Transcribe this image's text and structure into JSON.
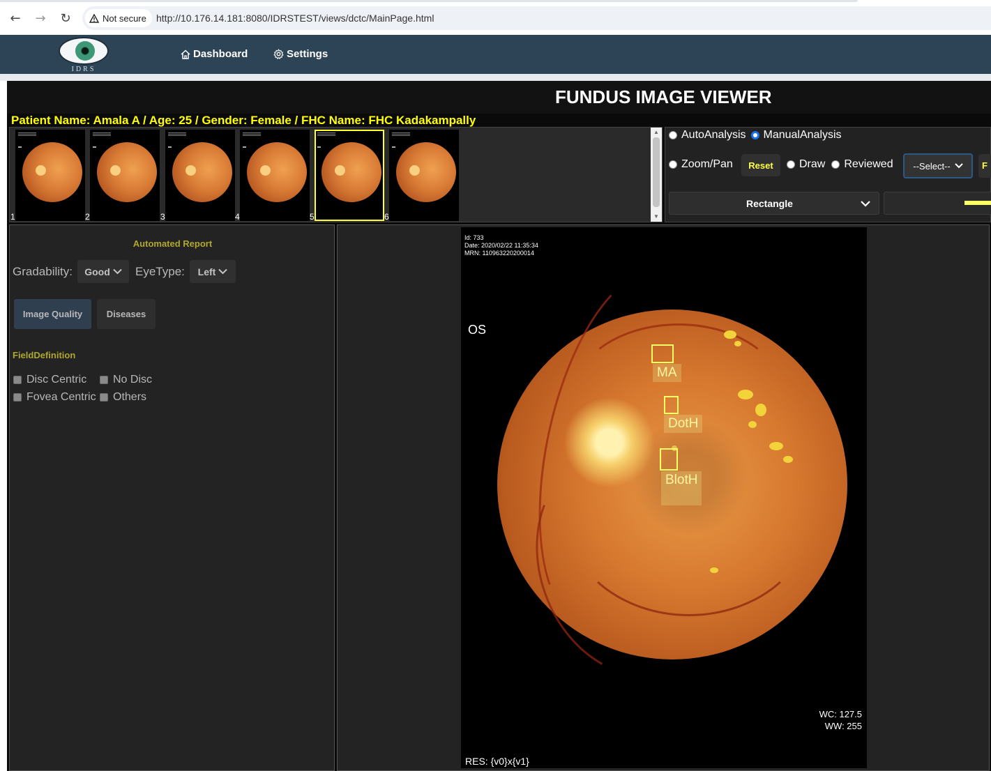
{
  "browser": {
    "security_label": "Not secure",
    "url": "http://10.176.14.181:8080/IDRSTEST/views/dctc/MainPage.html"
  },
  "app": {
    "logo_text": "IDRS",
    "menu": {
      "dashboard": "Dashboard",
      "settings": "Settings"
    },
    "viewer_title": "FUNDUS IMAGE VIEWER",
    "patient_line": "Patient Name: Amala A /  Age: 25 /  Gender: Female /  FHC Name: FHC Kadakampally"
  },
  "thumbnails": {
    "items": [
      {
        "num": "1"
      },
      {
        "num": "2"
      },
      {
        "num": "3"
      },
      {
        "num": "4"
      },
      {
        "num": "5"
      },
      {
        "num": "6"
      }
    ],
    "selected_index": 5
  },
  "tools": {
    "auto_analysis": "AutoAnalysis",
    "manual_analysis": "ManualAnalysis",
    "zoom_pan": "Zoom/Pan",
    "reset": "Reset",
    "draw": "Draw",
    "reviewed": "Reviewed",
    "select_value": "--Select--",
    "partial_button": "F",
    "shape_value": "Rectangle",
    "highlight_color": "#ffff66"
  },
  "report": {
    "title": "Automated Report",
    "gradability_label": "Gradability:",
    "gradability_value": "Good",
    "eyetype_label": "EyeType:",
    "eyetype_value": "Left",
    "tab_image_quality": "Image Quality",
    "tab_diseases": "Diseases",
    "field_definition_title": "FieldDefinition",
    "checkboxes": {
      "disc_centric": "Disc Centric",
      "no_disc": "No Disc",
      "fovea_centric": "Fovea Centric",
      "others": "Others"
    }
  },
  "image": {
    "meta_id": "Id: 733",
    "meta_date": "Date: 2020/02/22 11:35:34",
    "meta_mrn": "MRN: 110963220200014",
    "eye_label": "OS",
    "annotations": {
      "ma": "MA",
      "doth": "DotH",
      "bloth": "BlotH"
    },
    "wc": "WC: 127.5",
    "ww": "WW: 255",
    "res": "RES: {v0}x{v1}"
  }
}
